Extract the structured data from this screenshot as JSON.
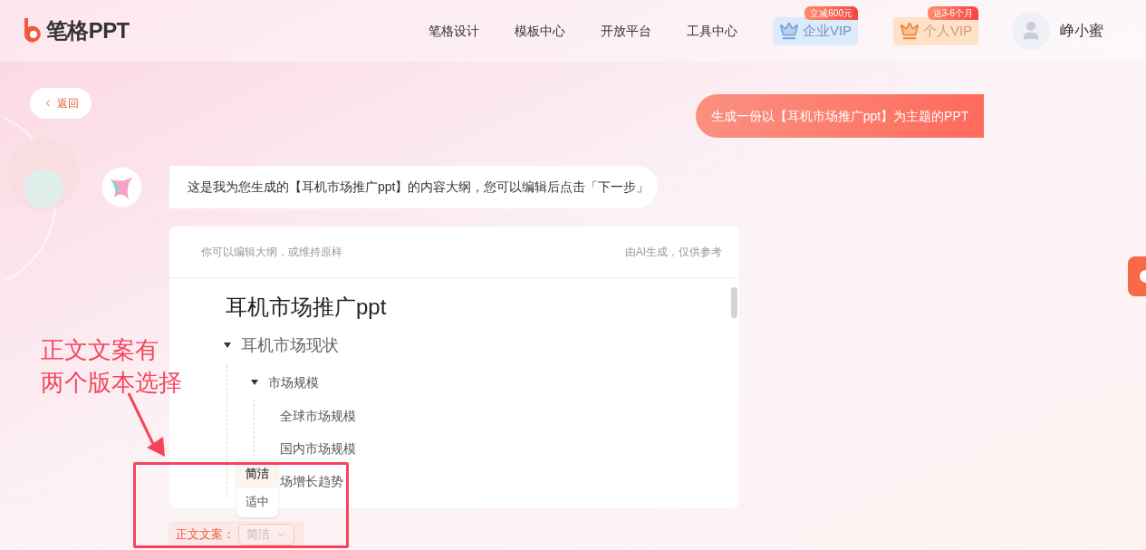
{
  "header": {
    "logo_text": "笔格PPT",
    "nav": [
      "笔格设计",
      "模板中心",
      "开放平台",
      "工具中心"
    ],
    "vip": [
      {
        "kind": "enterprise",
        "label": "企业VIP",
        "badge": "立减600元"
      },
      {
        "kind": "personal",
        "label": "个人VIP",
        "badge": "送3-6个月"
      }
    ],
    "user": {
      "name": "峥小蜜"
    }
  },
  "back_button": "返回",
  "user_message": "生成一份以【耳机市场推广ppt】为主题的PPT",
  "bot_message": "这是我为您生成的【耳机市场推广ppt】的内容大纲，您可以编辑后点击「下一步」",
  "outline": {
    "hint": "你可以编辑大纲，或维持原样",
    "note": "由AI生成，仅供参考",
    "title": "耳机市场推广ppt",
    "items": [
      {
        "label": "耳机市场现状",
        "expanded": true,
        "children": [
          {
            "label": "市场规模",
            "expanded": true,
            "children": [
              {
                "label": "全球市场规模"
              },
              {
                "label": "国内市场规模"
              },
              {
                "label": "场增长趋势"
              }
            ]
          }
        ]
      }
    ]
  },
  "copy_style": {
    "label": "正文文案：",
    "value": "简洁",
    "options": [
      {
        "label": "简洁",
        "selected": true
      },
      {
        "label": "适中",
        "selected": false
      }
    ]
  },
  "annotation": {
    "lines": [
      "正文文案有",
      "两个版本选择"
    ]
  }
}
